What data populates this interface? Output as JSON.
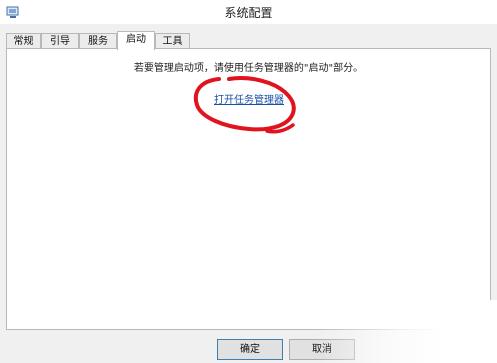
{
  "window": {
    "title": "系统配置"
  },
  "tabs": [
    {
      "label": "常规"
    },
    {
      "label": "引导"
    },
    {
      "label": "服务"
    },
    {
      "label": "启动",
      "active": true
    },
    {
      "label": "工具"
    }
  ],
  "startup": {
    "message": "若要管理启动项，请使用任务管理器的\"启动\"部分。",
    "link_label": "打开任务管理器"
  },
  "buttons": {
    "ok_label": "确定",
    "cancel_label": "取消"
  },
  "colors": {
    "accent_link": "#1a4fa8",
    "annotation": "#e0141e"
  },
  "icons": {
    "title": "system-config-icon"
  }
}
